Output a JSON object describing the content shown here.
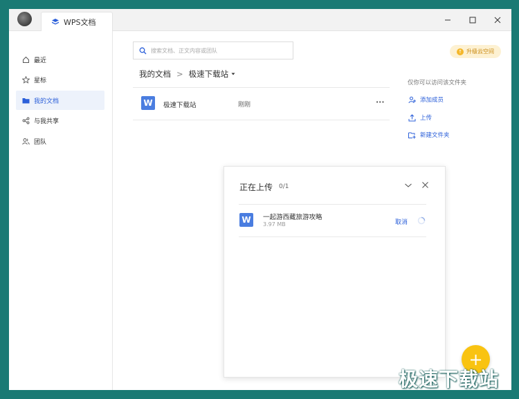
{
  "tab": {
    "title": "WPS文档"
  },
  "sidebar": {
    "items": [
      {
        "label": "最近",
        "icon": "home-icon"
      },
      {
        "label": "星标",
        "icon": "star-icon"
      },
      {
        "label": "我的文档",
        "icon": "folder-icon",
        "active": true
      },
      {
        "label": "与我共享",
        "icon": "share-icon"
      },
      {
        "label": "团队",
        "icon": "team-icon"
      }
    ]
  },
  "search": {
    "placeholder": "搜索文档、正文内容或团队"
  },
  "upgrade": {
    "label": "升级云空间"
  },
  "breadcrumb": {
    "root": "我的文档",
    "separator": ">",
    "current": "极速下载站"
  },
  "files": [
    {
      "name": "极速下载站",
      "time": "刚刚",
      "more": "···"
    }
  ],
  "right_panel": {
    "access_note": "仅你可以访问该文件夹",
    "actions": [
      {
        "label": "添加成员",
        "icon": "add-member-icon"
      },
      {
        "label": "上传",
        "icon": "upload-icon"
      },
      {
        "label": "新建文件夹",
        "icon": "new-folder-icon"
      }
    ]
  },
  "upload_panel": {
    "title": "正在上传",
    "count": "0/1",
    "items": [
      {
        "name": "一起游西藏旅游攻略",
        "size": "3.97 MB",
        "cancel": "取消"
      }
    ]
  },
  "fab": {
    "label": "+"
  },
  "watermark": {
    "text": "极速下载站"
  }
}
